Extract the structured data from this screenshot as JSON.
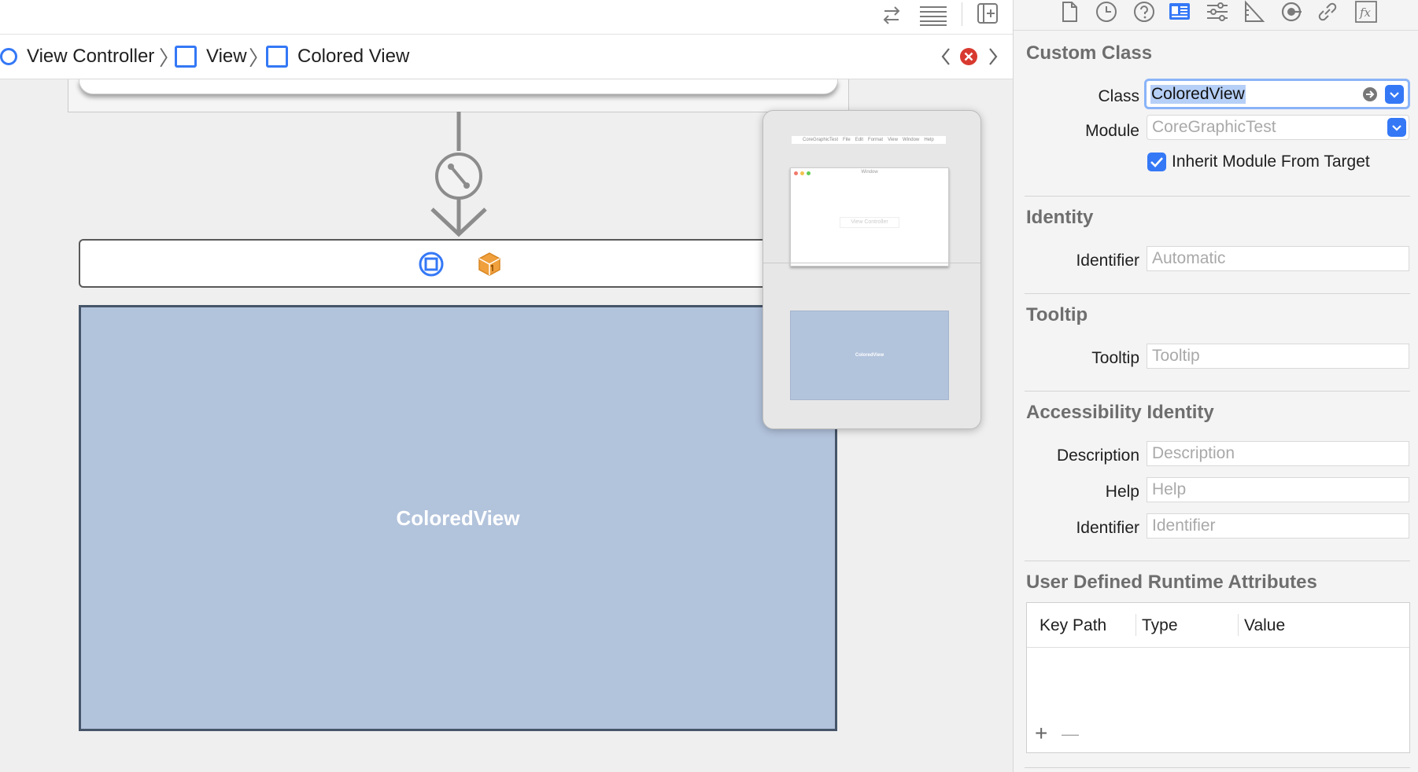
{
  "breadcrumb": {
    "items": [
      "View Controller",
      "View",
      "Colored View"
    ]
  },
  "canvas": {
    "colored_view_label": "ColoredView",
    "preview_menu": [
      "CoreGraphicTest",
      "File",
      "Edit",
      "Format",
      "View",
      "Window",
      "Help"
    ],
    "preview_window_title": "Window",
    "preview_vc_label": "View Controller",
    "preview_colored_label": "ColoredView"
  },
  "inspector": {
    "custom_class": {
      "title": "Custom Class",
      "class_label": "Class",
      "class_value": "ColoredView",
      "module_label": "Module",
      "module_placeholder": "CoreGraphicTest",
      "inherit_label": "Inherit Module From Target",
      "inherit_checked": true
    },
    "identity": {
      "title": "Identity",
      "identifier_label": "Identifier",
      "identifier_placeholder": "Automatic"
    },
    "tooltip": {
      "title": "Tooltip",
      "tooltip_label": "Tooltip",
      "tooltip_placeholder": "Tooltip"
    },
    "accessibility": {
      "title": "Accessibility Identity",
      "description_label": "Description",
      "description_placeholder": "Description",
      "help_label": "Help",
      "help_placeholder": "Help",
      "identifier_label": "Identifier",
      "identifier_placeholder": "Identifier"
    },
    "runtime_attrs": {
      "title": "User Defined Runtime Attributes",
      "columns": [
        "Key Path",
        "Type",
        "Value"
      ],
      "add_label": "+",
      "remove_label": "—"
    }
  },
  "colors": {
    "accent": "#3478f6",
    "colored_view_fill": "#b2c3dc",
    "warning_red": "#d83a2f",
    "object_orange": "#f0a03c"
  }
}
